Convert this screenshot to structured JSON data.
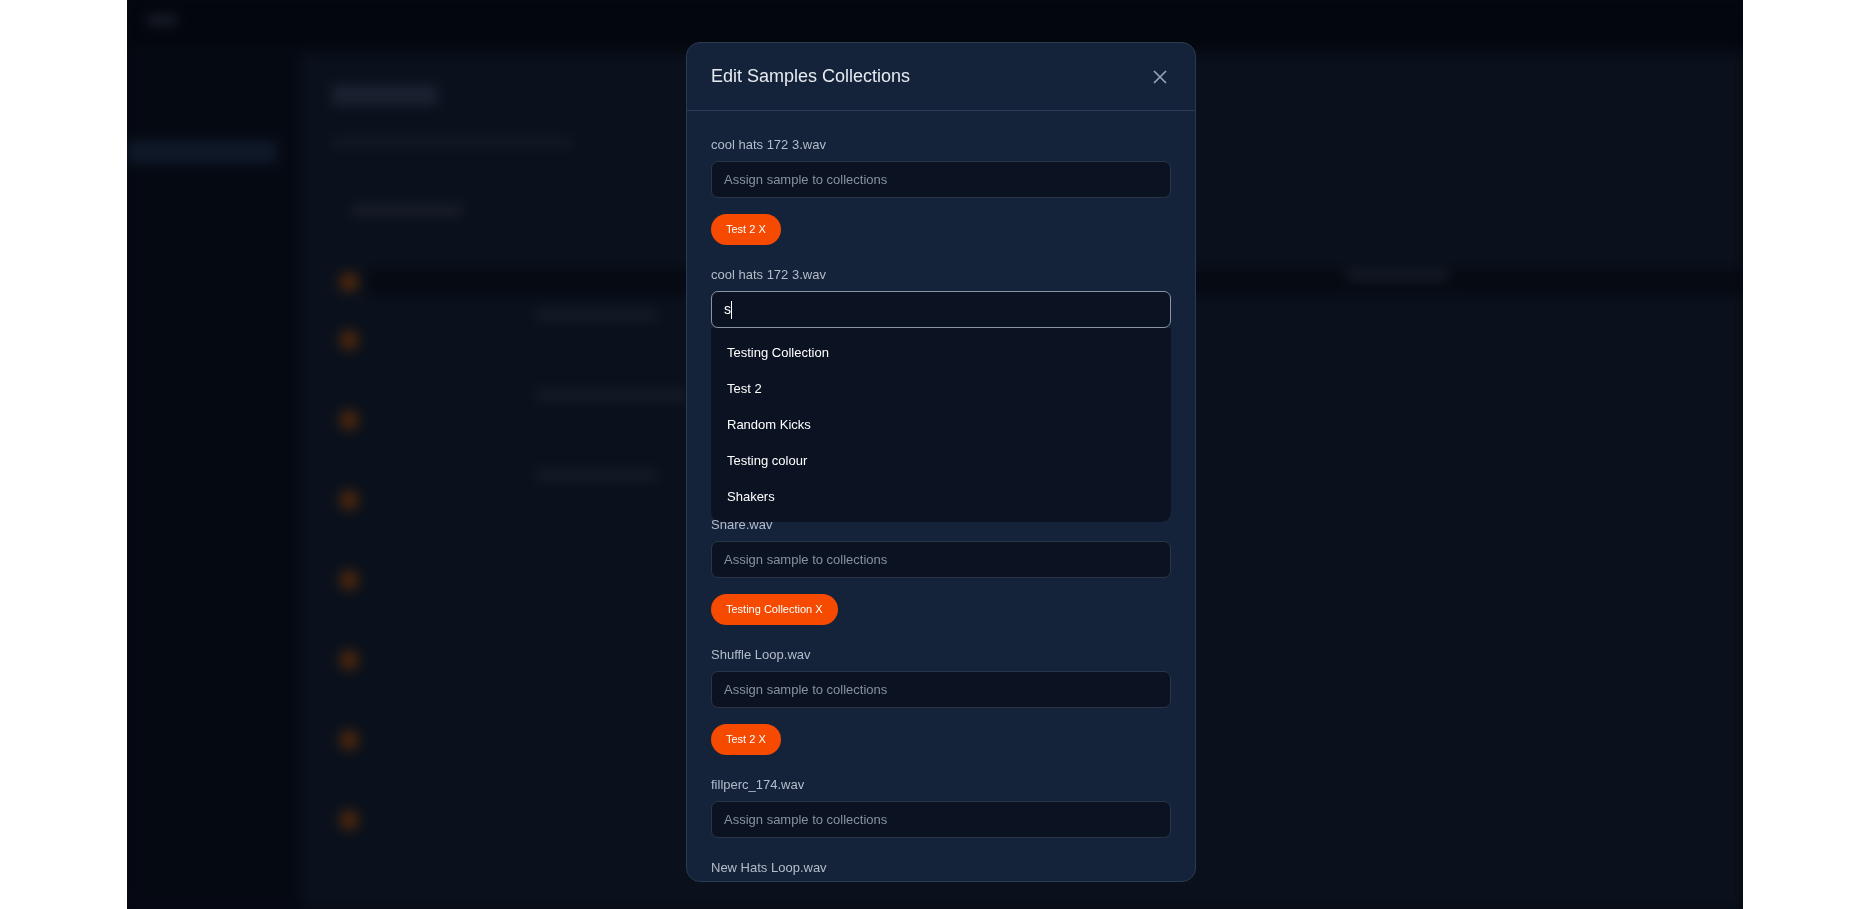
{
  "dialog": {
    "title": "Edit Samples Collections",
    "samples": [
      {
        "name": "cool hats 172 3.wav",
        "input": {
          "placeholder": "Assign sample to collections",
          "focused": false
        },
        "collections": [
          "Test 2 X"
        ]
      },
      {
        "name": "cool hats 172 3.wav",
        "input": {
          "value": "s",
          "focused": true
        },
        "suggestions": [
          "Testing Collection",
          "Test 2",
          "Random Kicks",
          "Testing colour",
          "Shakers"
        ]
      },
      {
        "name": "Snare.wav",
        "input": {
          "placeholder": "Assign sample to collections",
          "focused": false
        },
        "collections": [
          "Testing Collection X"
        ]
      },
      {
        "name": "Shuffle Loop.wav",
        "input": {
          "placeholder": "Assign sample to collections",
          "focused": false
        },
        "collections": [
          "Test 2 X"
        ]
      },
      {
        "name": "fillperc_174.wav",
        "input": {
          "placeholder": "Assign sample to collections",
          "focused": false
        }
      },
      {
        "name": "New Hats Loop.wav"
      }
    ]
  }
}
